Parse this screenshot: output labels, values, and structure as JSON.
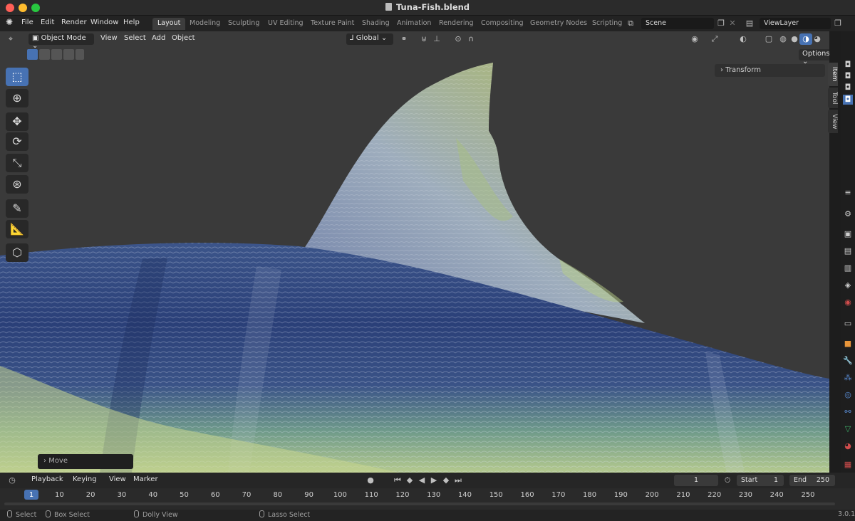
{
  "window": {
    "title": "Tuna-Fish.blend"
  },
  "menu": [
    "File",
    "Edit",
    "Render",
    "Window",
    "Help"
  ],
  "workspaces": [
    "Layout",
    "Modeling",
    "Sculpting",
    "UV Editing",
    "Texture Paint",
    "Shading",
    "Animation",
    "Rendering",
    "Compositing",
    "Geometry Nodes",
    "Scripting"
  ],
  "active_workspace": "Layout",
  "scene": {
    "name": "Scene"
  },
  "view_layer": {
    "name": "ViewLayer"
  },
  "viewport_header": {
    "mode": "Object Mode",
    "menus": [
      "View",
      "Select",
      "Add",
      "Object"
    ],
    "orientation": "Global",
    "options_label": "Options"
  },
  "transform_panel": {
    "label": "Transform"
  },
  "npanel_tabs": [
    "Item",
    "Tool",
    "View"
  ],
  "tools": [
    "select-box",
    "cursor",
    "move",
    "rotate",
    "scale",
    "transform",
    "annotate",
    "measure",
    "add-cube"
  ],
  "last_op": {
    "label": "Move"
  },
  "timeline": {
    "menus": [
      "Playback",
      "Keying",
      "View",
      "Marker"
    ],
    "current_frame": "1",
    "start_label": "Start",
    "start": "1",
    "end_label": "End",
    "end": "250",
    "ruler": [
      "1",
      "10",
      "20",
      "30",
      "40",
      "50",
      "60",
      "70",
      "80",
      "90",
      "100",
      "110",
      "120",
      "130",
      "140",
      "150",
      "160",
      "170",
      "180",
      "190",
      "200",
      "210",
      "220",
      "230",
      "240",
      "250"
    ]
  },
  "status": {
    "select": "Select",
    "box_select": "Box Select",
    "dolly": "Dolly View",
    "lasso": "Lasso Select",
    "version": "3.0.1"
  },
  "colors": {
    "accent": "#4772b3",
    "viewport_bg": "#3a3a3a",
    "header_bg": "#232323"
  }
}
